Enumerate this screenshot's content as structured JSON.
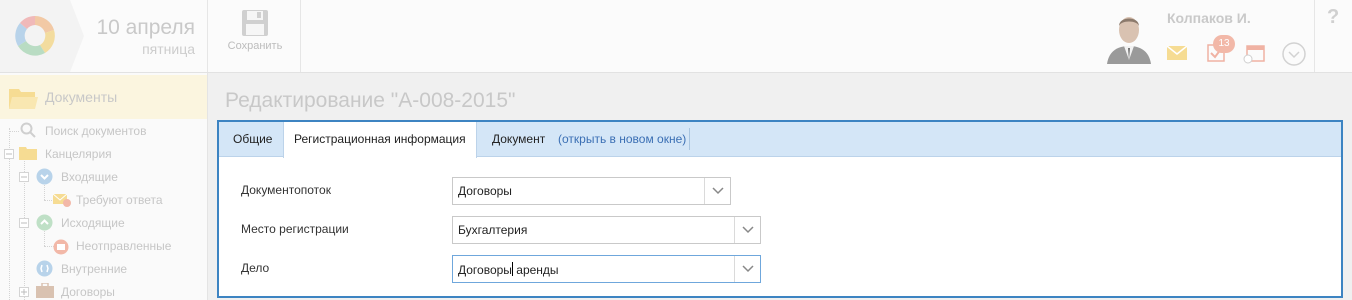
{
  "header": {
    "date_day": "10 апреля",
    "date_weekday": "пятница",
    "save_label": "Сохранить",
    "user_name": "Колпаков И.",
    "tasks_badge": "13",
    "help": "?"
  },
  "sidebar": {
    "title": "Документы",
    "items": [
      {
        "label": "Поиск документов",
        "icon": "search-icon"
      },
      {
        "label": "Канцелярия",
        "icon": "folder-icon"
      },
      {
        "label": "Входящие",
        "icon": "inbox-icon"
      },
      {
        "label": "Требуют ответа",
        "icon": "mail-warning-icon"
      },
      {
        "label": "Исходящие",
        "icon": "outbox-icon"
      },
      {
        "label": "Неотправленные",
        "icon": "mail-unsent-icon"
      },
      {
        "label": "Внутренние",
        "icon": "internal-doc-icon"
      },
      {
        "label": "Договоры",
        "icon": "briefcase-icon"
      }
    ]
  },
  "page": {
    "title": "Редактирование \"А-008-2015\""
  },
  "tabs": [
    {
      "label": "Общие"
    },
    {
      "label": "Регистрационная информация"
    },
    {
      "label": "Документ"
    }
  ],
  "tab_link": "(открыть в новом окне)",
  "form": {
    "docflow_label": "Документопоток",
    "docflow_value": "Договоры",
    "place_label": "Место регистрации",
    "place_value": "Бухгалтерия",
    "case_label": "Дело",
    "case_value_before": "Договоры",
    "case_value_after": " аренды"
  },
  "colors": {
    "accent": "#3d84c2",
    "tab_bar": "#d4e6f7",
    "badge": "#f2b8a8"
  }
}
